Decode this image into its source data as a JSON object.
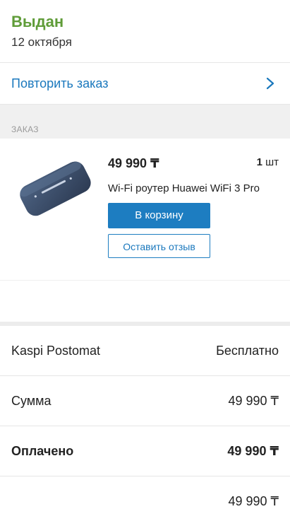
{
  "status": {
    "title": "Выдан",
    "date": "12 октября"
  },
  "repeat": {
    "label": "Повторить заказ"
  },
  "section": {
    "label": "ЗАКАЗ"
  },
  "order": {
    "price": "49 990 ₸",
    "qty_number": "1",
    "qty_unit": "шт",
    "name": "Wi-Fi роутер Huawei WiFi 3 Pro",
    "cart_button": "В корзину",
    "review_button": "Оставить отзыв"
  },
  "summary": [
    {
      "label": "Kaspi Postomat",
      "value": "Бесплатно"
    },
    {
      "label": "Сумма",
      "value": "49 990 ₸"
    },
    {
      "label": "Оплачено",
      "value": "49 990 ₸"
    },
    {
      "label": "",
      "value": "49 990 ₸"
    }
  ],
  "colors": {
    "status": "#5f9c38",
    "accent": "#1d7dc1"
  },
  "icons": {
    "repeat_chevron": "chevron-right-icon"
  }
}
